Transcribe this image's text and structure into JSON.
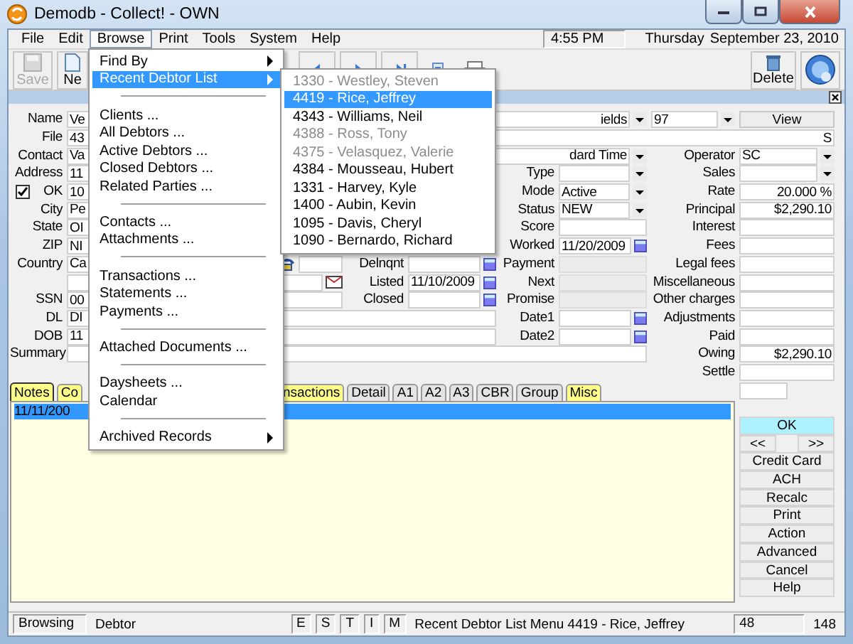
{
  "window": {
    "title": "Demodb - Collect! - OWN"
  },
  "menu_bar": {
    "items": [
      {
        "label": "File",
        "selected": false
      },
      {
        "label": "Edit",
        "selected": false
      },
      {
        "label": "Browse",
        "selected": true
      },
      {
        "label": "Print",
        "selected": false
      },
      {
        "label": "Tools",
        "selected": false
      },
      {
        "label": "System",
        "selected": false
      },
      {
        "label": "Help",
        "selected": false
      }
    ],
    "time": "4:55 PM",
    "day": "Thursday",
    "date": "September 23, 2010"
  },
  "toolbar": {
    "buttons": [
      {
        "label": "Save",
        "disabled": true
      },
      {
        "label": "Ne",
        "disabled": false
      }
    ],
    "delete_label": "Delete"
  },
  "browse_menu": [
    {
      "kind": "item",
      "label": "Find By",
      "submenu": true,
      "selected": false
    },
    {
      "kind": "item",
      "label": "Recent Debtor List",
      "submenu": true,
      "selected": true
    },
    {
      "kind": "separator"
    },
    {
      "kind": "item",
      "label": "Clients ...",
      "submenu": false,
      "selected": false
    },
    {
      "kind": "item",
      "label": "All Debtors ...",
      "submenu": false,
      "selected": false
    },
    {
      "kind": "item",
      "label": "Active Debtors ...",
      "submenu": false,
      "selected": false
    },
    {
      "kind": "item",
      "label": "Closed Debtors ...",
      "submenu": false,
      "selected": false
    },
    {
      "kind": "item",
      "label": "Related Parties ...",
      "submenu": false,
      "selected": false
    },
    {
      "kind": "separator"
    },
    {
      "kind": "item",
      "label": "Contacts ...",
      "submenu": false,
      "selected": false
    },
    {
      "kind": "item",
      "label": "Attachments ...",
      "submenu": false,
      "selected": false
    },
    {
      "kind": "separator"
    },
    {
      "kind": "item",
      "label": "Transactions ...",
      "submenu": false,
      "selected": false
    },
    {
      "kind": "item",
      "label": "Statements ...",
      "submenu": false,
      "selected": false
    },
    {
      "kind": "item",
      "label": "Payments ...",
      "submenu": false,
      "selected": false
    },
    {
      "kind": "separator"
    },
    {
      "kind": "item",
      "label": "Attached Documents ...",
      "submenu": false,
      "selected": false
    },
    {
      "kind": "separator"
    },
    {
      "kind": "item",
      "label": "Daysheets ...",
      "submenu": false,
      "selected": false
    },
    {
      "kind": "item",
      "label": "Calendar",
      "submenu": false,
      "selected": false
    },
    {
      "kind": "separator"
    },
    {
      "kind": "item",
      "label": "Archived Records",
      "submenu": true,
      "selected": false
    }
  ],
  "recent_debtors": [
    {
      "label": "1330 - Westley, Steven",
      "disabled": true,
      "selected": false
    },
    {
      "label": "4419 - Rice, Jeffrey",
      "disabled": false,
      "selected": true
    },
    {
      "label": "4343 - Williams, Neil",
      "disabled": false,
      "selected": false
    },
    {
      "label": "4388 - Ross, Tony",
      "disabled": true,
      "selected": false
    },
    {
      "label": "4375 - Velasquez, Valerie",
      "disabled": true,
      "selected": false
    },
    {
      "label": "4384 - Mousseau, Hubert",
      "disabled": false,
      "selected": false
    },
    {
      "label": "1331 - Harvey, Kyle",
      "disabled": false,
      "selected": false
    },
    {
      "label": "1400 - Aubin, Kevin",
      "disabled": false,
      "selected": false
    },
    {
      "label": "1095 - Davis, Cheryl",
      "disabled": false,
      "selected": false
    },
    {
      "label": "1090 - Bernardo, Richard",
      "disabled": false,
      "selected": false
    }
  ],
  "debtor_form": {
    "left_fields": [
      {
        "label": "Name",
        "kind": "dropdown",
        "values": [
          "Ve",
          "ields"
        ]
      },
      {
        "label": "File",
        "kind": "text",
        "values": [
          "43",
          "S"
        ]
      },
      {
        "label": "Contact",
        "kind": "dropdown",
        "values": [
          "Va",
          "dard Time"
        ]
      },
      {
        "label": "Address",
        "kind": "text",
        "values": [
          "11"
        ]
      },
      {
        "label": "OK",
        "kind": "checkbox",
        "checked": true,
        "values": [
          "10"
        ]
      },
      {
        "label": "City",
        "kind": "text",
        "values": [
          "Pe"
        ]
      },
      {
        "label": "State",
        "kind": "text",
        "values": [
          "OI"
        ]
      },
      {
        "label": "ZIP",
        "kind": "text",
        "values": [
          "NI"
        ]
      },
      {
        "label": "Country",
        "kind": "text",
        "values": [
          "Ca"
        ]
      },
      {
        "label": "SSN",
        "kind": "text",
        "values": [
          "00"
        ]
      },
      {
        "label": "DL",
        "kind": "text",
        "values": [
          "DI"
        ]
      },
      {
        "label": "DOB",
        "kind": "text",
        "values": [
          "11"
        ]
      },
      {
        "label": "Summary",
        "kind": "text"
      }
    ],
    "contact_fields": [
      {
        "kind": "phone"
      },
      {
        "kind": "email"
      }
    ],
    "name_code": "97",
    "view_button": "View",
    "dates": [
      {
        "label": "Delnqnt"
      },
      {
        "label": "Listed",
        "value": "11/10/2009"
      },
      {
        "label": "Closed"
      }
    ],
    "status": [
      {
        "label": "Type",
        "kind": "dropdown"
      },
      {
        "label": "Mode",
        "kind": "dropdown",
        "value": "Active"
      },
      {
        "label": "Status",
        "kind": "dropdown",
        "value": "NEW"
      },
      {
        "label": "Score",
        "kind": "text"
      },
      {
        "label": "Worked",
        "kind": "date",
        "value": "11/20/2009"
      },
      {
        "label": "Payment",
        "kind": "readonly"
      },
      {
        "label": "Next",
        "kind": "readonly"
      },
      {
        "label": "Promise",
        "kind": "readonly"
      },
      {
        "label": "Date1",
        "kind": "date"
      },
      {
        "label": "Date2",
        "kind": "date"
      }
    ],
    "amounts": [
      {
        "label": "Operator",
        "kind": "dropdown",
        "value": "SC"
      },
      {
        "label": "Sales",
        "kind": "dropdown"
      },
      {
        "label": "Rate",
        "kind": "text",
        "value": "20.000 %"
      },
      {
        "label": "Principal",
        "kind": "text",
        "value": "$2,290.10"
      },
      {
        "label": "Interest",
        "kind": "text"
      },
      {
        "label": "Fees",
        "kind": "text"
      },
      {
        "label": "Legal fees",
        "kind": "text"
      },
      {
        "label": "Miscellaneous",
        "kind": "text"
      },
      {
        "label": "Other charges",
        "kind": "text"
      },
      {
        "label": "Adjustments",
        "kind": "text"
      },
      {
        "label": "Paid",
        "kind": "text"
      },
      {
        "label": "Owing",
        "kind": "text",
        "value": "$2,290.10"
      },
      {
        "label": "Settle",
        "kind": "text"
      }
    ]
  },
  "tabs": [
    {
      "label": "Notes",
      "selected": true,
      "highlighted": true
    },
    {
      "label": "Co",
      "selected": false,
      "highlighted": true
    },
    {
      "label": "nsactions",
      "selected": false,
      "highlighted": true
    },
    {
      "label": "Detail",
      "selected": false,
      "highlighted": false
    },
    {
      "label": "A1",
      "selected": false,
      "highlighted": false
    },
    {
      "label": "A2",
      "selected": false,
      "highlighted": false
    },
    {
      "label": "A3",
      "selected": false,
      "highlighted": false
    },
    {
      "label": "CBR",
      "selected": false,
      "highlighted": false
    },
    {
      "label": "Group",
      "selected": false,
      "highlighted": false
    },
    {
      "label": "Misc",
      "selected": false,
      "highlighted": true
    }
  ],
  "notes": [
    {
      "date": "11/11/200",
      "selected": true
    }
  ],
  "record_nav": [
    "<<",
    ">>"
  ],
  "side_buttons": [
    {
      "label": "OK",
      "default": true
    },
    {
      "label": "Credit Card",
      "default": false
    },
    {
      "label": "ACH",
      "default": false
    },
    {
      "label": "Recalc",
      "default": false
    },
    {
      "label": "Print",
      "default": false
    },
    {
      "label": "Action",
      "default": false
    },
    {
      "label": "Advanced",
      "default": false
    },
    {
      "label": "Cancel",
      "default": false
    },
    {
      "label": "Help",
      "default": false
    }
  ],
  "status_bar": {
    "mode": "Browsing",
    "context": "Debtor",
    "flags": [
      "E",
      "S",
      "T",
      "I",
      "M"
    ],
    "message": "Recent Debtor List Menu 4419 - Rice, Jeffrey",
    "count": "48",
    "total": "148"
  }
}
